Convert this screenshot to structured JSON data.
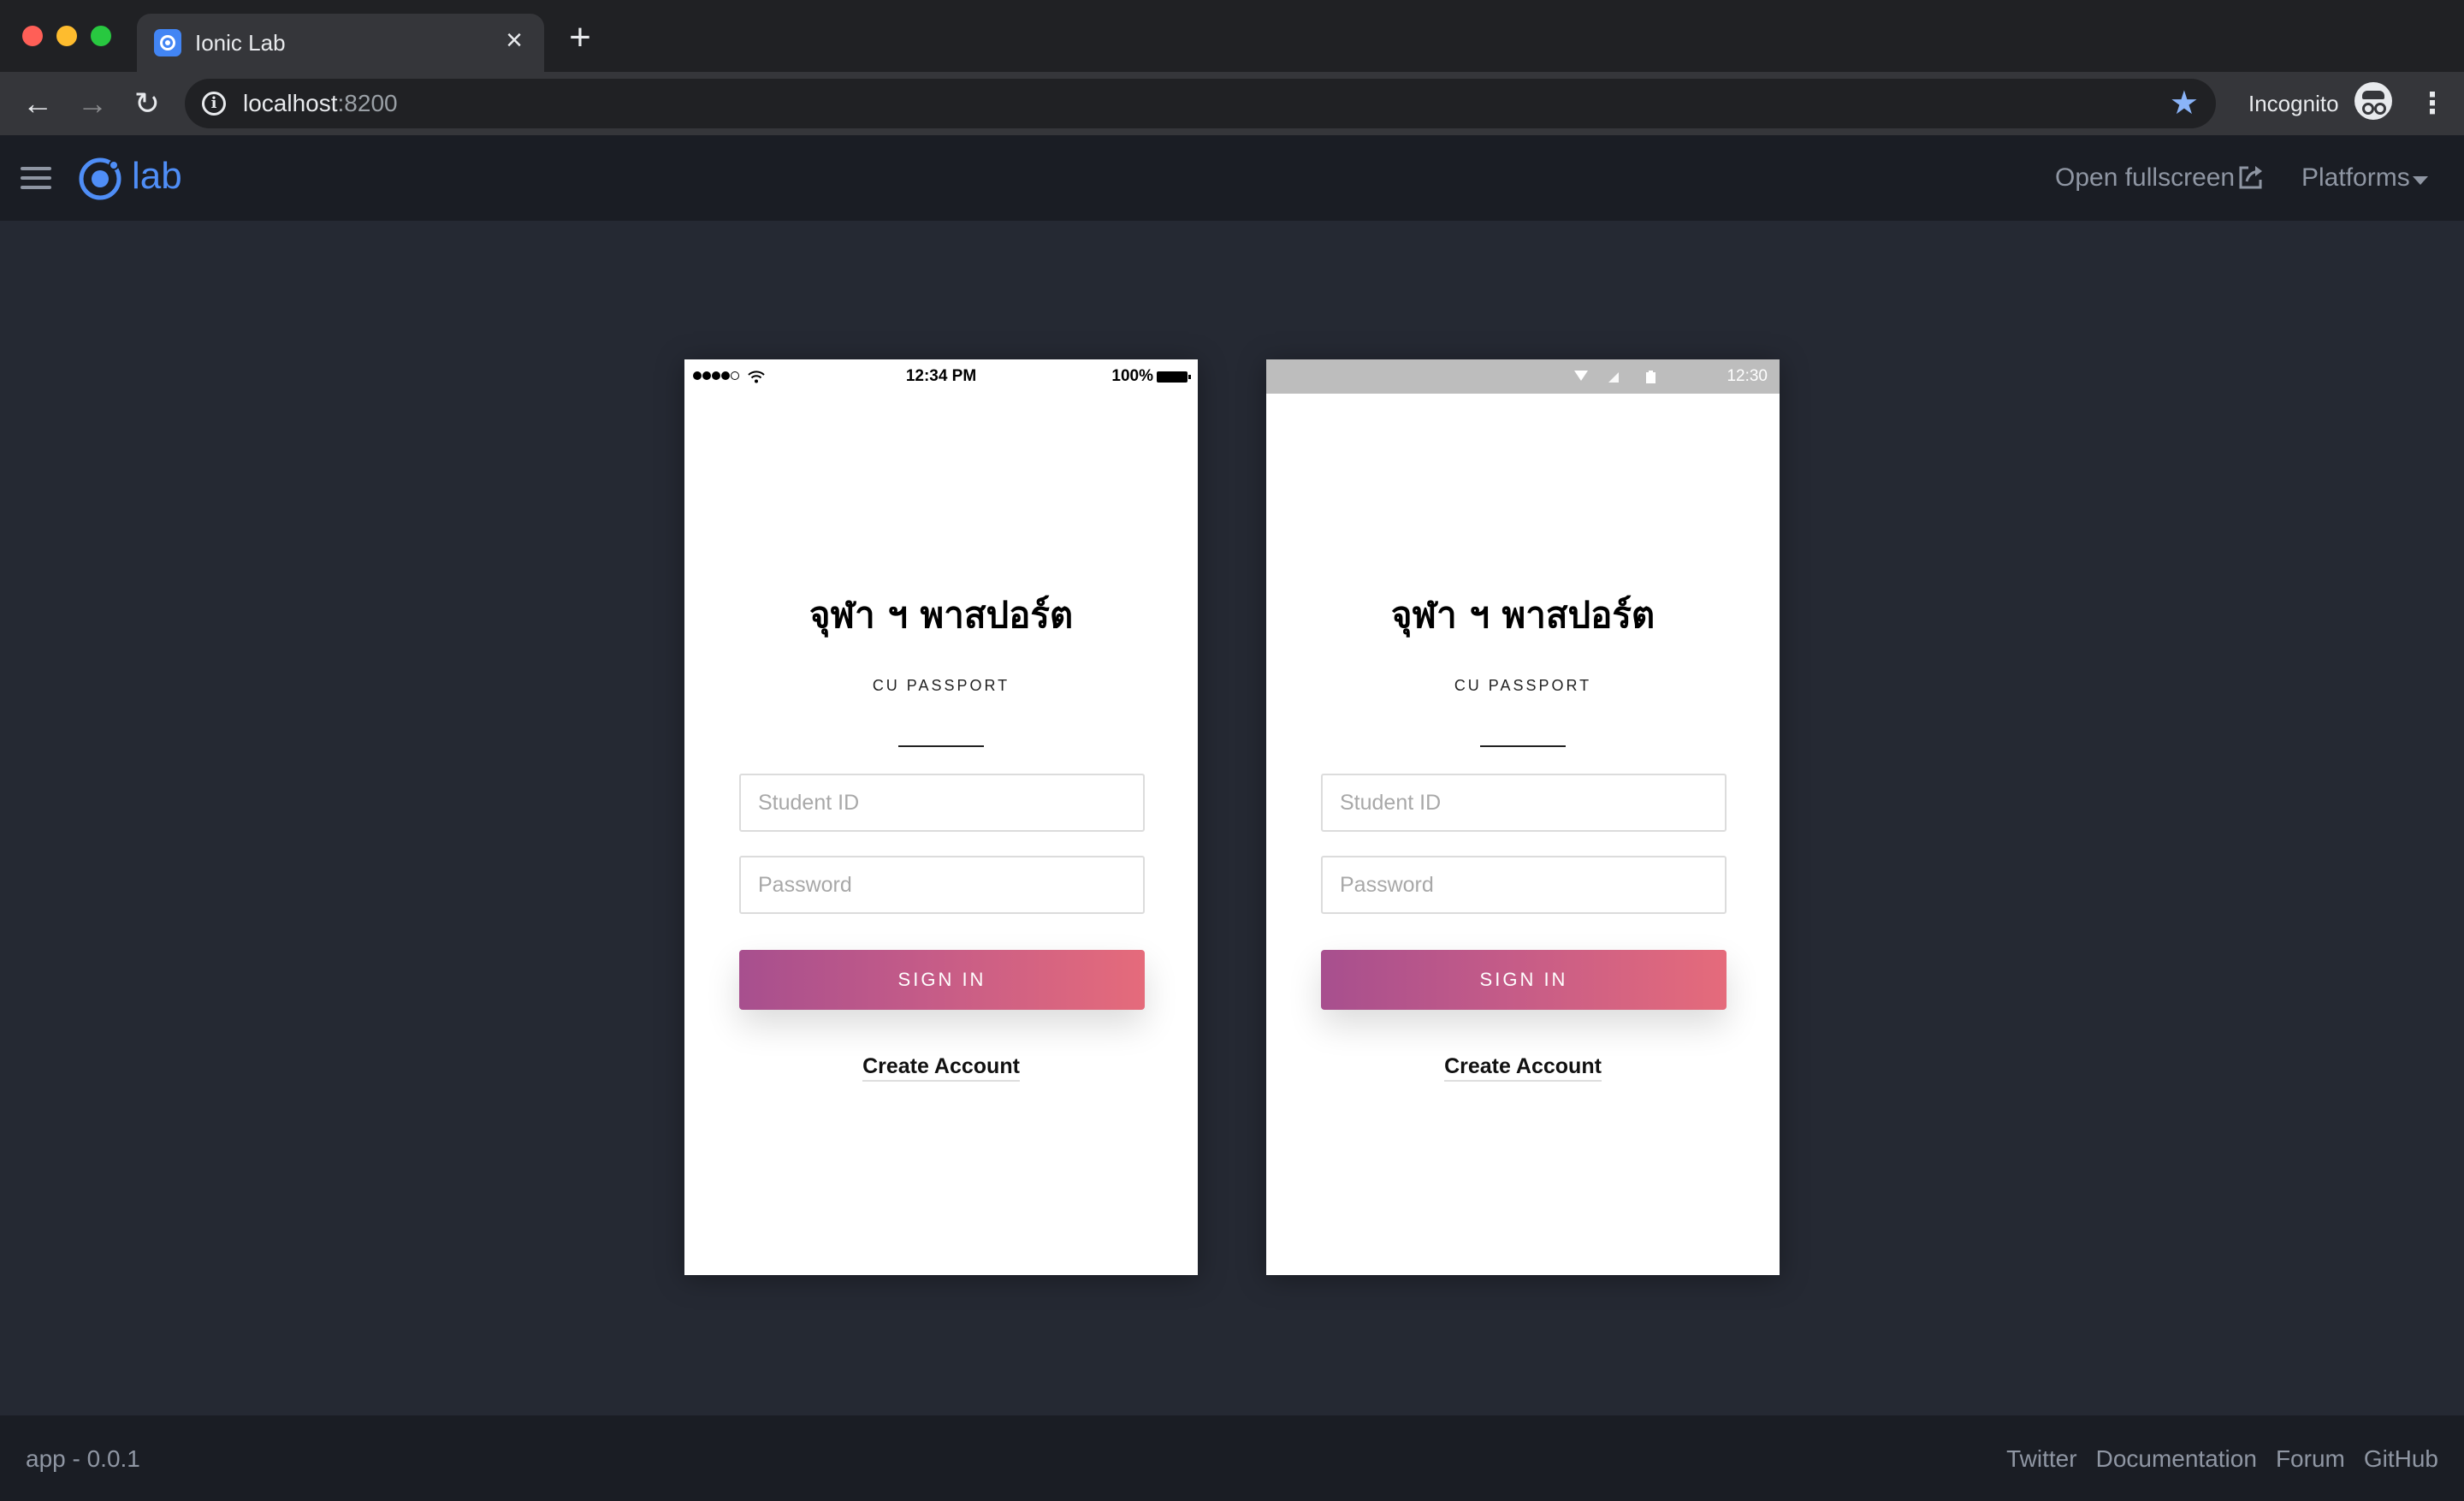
{
  "browser": {
    "tab_title": "Ionic Lab",
    "url_host": "localhost",
    "url_port": ":8200",
    "incognito_label": "Incognito"
  },
  "lab": {
    "logo_text": "lab",
    "open_fullscreen": "Open fullscreen",
    "platforms": "Platforms",
    "accent": "#4f8ef7"
  },
  "devices": {
    "ios": {
      "status_time": "12:34 PM",
      "battery": "100%"
    },
    "android": {
      "status_time": "12:30"
    }
  },
  "app": {
    "title": "จุฬา ฯ พาสปอร์ต",
    "subtitle": "CU PASSPORT",
    "student_id_placeholder": "Student ID",
    "password_placeholder": "Password",
    "signin_label": "SIGN IN",
    "create_account": "Create Account",
    "gradient_start": "#a74f8e",
    "gradient_end": "#e56b7b"
  },
  "footer": {
    "version": "app - 0.0.1",
    "links": [
      "Twitter",
      "Documentation",
      "Forum",
      "GitHub"
    ]
  }
}
